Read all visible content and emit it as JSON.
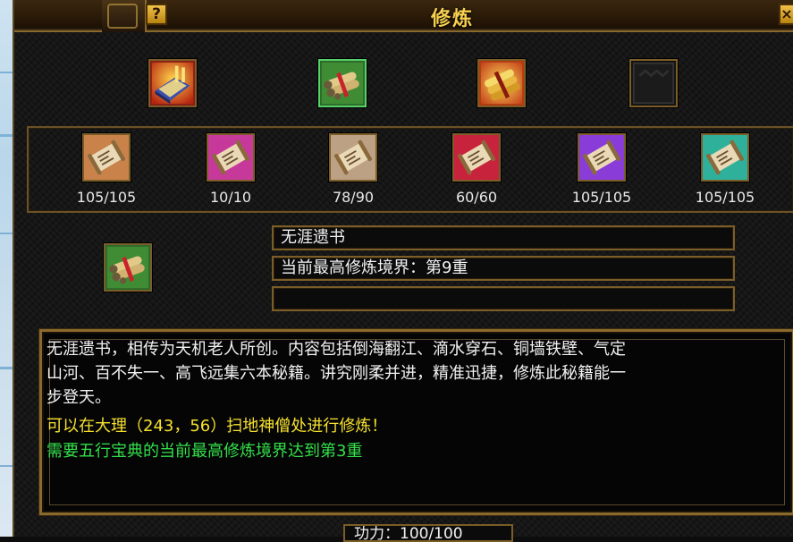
{
  "window": {
    "title": "修炼",
    "help_label": "?",
    "close_label": "×"
  },
  "top_items": [
    {
      "icon": "golden-book-icon",
      "selected": false
    },
    {
      "icon": "scroll-bundle-icon",
      "selected": true
    },
    {
      "icon": "golden-scroll-bundle-icon",
      "selected": false
    },
    {
      "icon": "empty-slot-icon",
      "selected": false
    }
  ],
  "scrolls": [
    {
      "icon": "tan-scroll-icon",
      "count": "105/105",
      "color": "#c8824a"
    },
    {
      "icon": "magenta-scroll-icon",
      "count": "10/10",
      "color": "#c63a9a"
    },
    {
      "icon": "beige-scroll-icon",
      "count": "78/90",
      "color": "#bca184"
    },
    {
      "icon": "red-scroll-icon",
      "count": "60/60",
      "color": "#c8233c"
    },
    {
      "icon": "purple-scroll-icon",
      "count": "105/105",
      "color": "#8a3cd8"
    },
    {
      "icon": "teal-scroll-icon",
      "count": "105/105",
      "color": "#2fb09a"
    }
  ],
  "detail": {
    "icon": "scroll-bundle-icon",
    "name": "无涯遗书",
    "realm": "当前最高修炼境界：第9重",
    "extra": ""
  },
  "description": {
    "lines": [
      "无涯遗书，相传为天机老人所创。内容包括倒海翻江、滴水穿石、铜墙铁壁、气定",
      "山河、百不失一、高飞远集六本秘籍。讲究刚柔并进，精准迅捷，修炼此秘籍能一",
      "步登天。"
    ],
    "location": "可以在大理（243，56）扫地神僧处进行修炼！",
    "requirement": "需要五行宝典的当前最高修炼境界达到第3重"
  },
  "bottom": {
    "label": "功力：100/100"
  },
  "colors": {
    "text_white": "#f2f2f2",
    "text_yellow": "#f5e12e",
    "text_green": "#33e04a",
    "title_gold": "#f7d04f",
    "frame_bronze": "#7a5d28"
  }
}
